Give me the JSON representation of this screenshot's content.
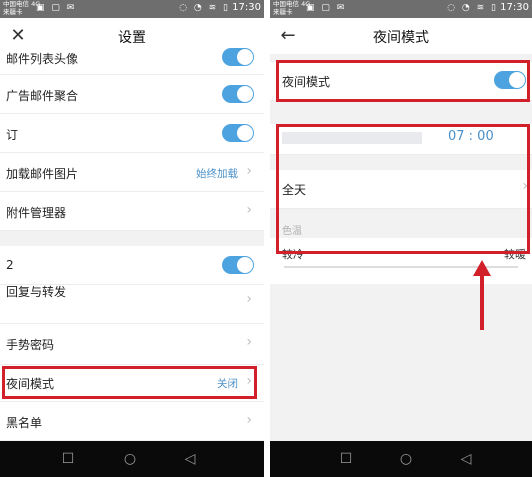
{
  "status": {
    "carrier_line1": "中国电信 4G",
    "carrier_line2": "来疆卡",
    "time": "17:30"
  },
  "left": {
    "title": "设置",
    "rows": {
      "mail_list_avatar": "邮件列表头像",
      "ad_aggregate": "广告邮件聚合",
      "partial_row": "订",
      "load_images": "加载邮件图片",
      "load_images_value": "始终加载",
      "attachment_manager": "附件管理器",
      "partial_row2": "2",
      "reply_forward": "回复与转发",
      "gesture_password": "手势密码",
      "night_mode": "夜间模式",
      "night_mode_value": "关闭",
      "blacklist": "黑名单"
    }
  },
  "right": {
    "title": "夜间模式",
    "night_mode_label": "夜间模式",
    "time_value": "07 : 00",
    "all_day": "全天",
    "color_temp": "色温",
    "cooler": "较冷",
    "warmer": "较暖"
  },
  "colors": {
    "toggle_on": "#4da3e0",
    "highlight": "#d1202a",
    "link_value": "#4a90c8"
  }
}
